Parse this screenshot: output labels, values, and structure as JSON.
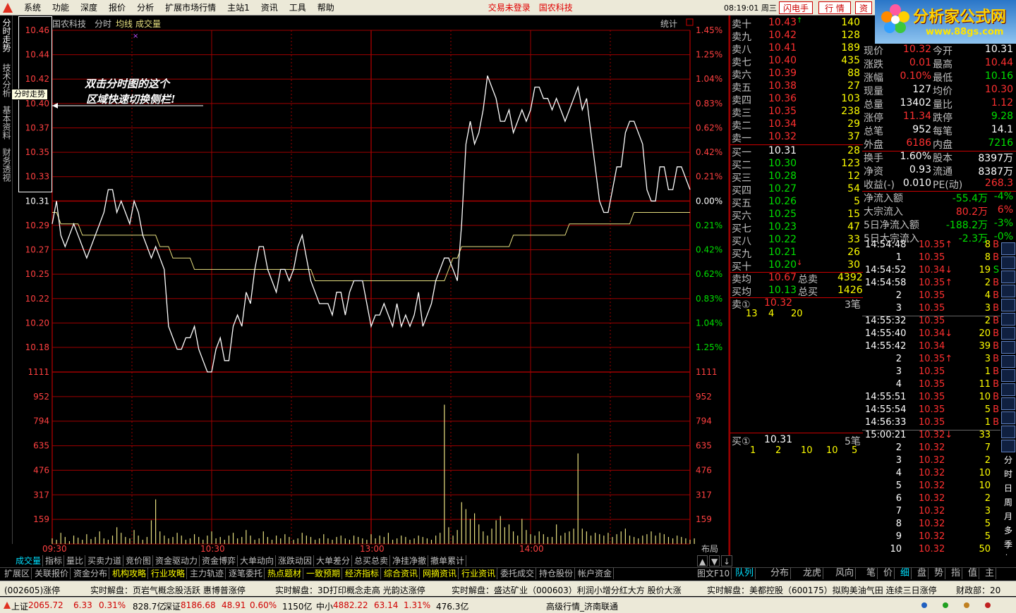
{
  "menu": {
    "items": [
      "系统",
      "功能",
      "深度",
      "报价",
      "分析",
      "扩展市场行情",
      "主站1",
      "资讯",
      "工具",
      "帮助"
    ],
    "status_login": "交易未登录",
    "stock_name_top": "国农科技",
    "clock": "08:19:01 周三",
    "btn_flash": "闪电手",
    "btn_quote": "行 情",
    "btn_asset": "资"
  },
  "brand": {
    "title": "分析家公式网",
    "url": "www.88gs.com",
    "code_faint": "000004 国农科技"
  },
  "side_tabs": [
    "分时走势",
    "技术分析",
    "基本资料",
    "财务透视"
  ],
  "tooltip": "分时走势",
  "annotation": [
    "双击分时图的这个",
    "区域快速切换侧栏!"
  ],
  "chart_header": {
    "name": "国农科技",
    "mode": "分时",
    "avg": "均线",
    "vol": "成交量",
    "stat": "统计",
    "close_box": "□"
  },
  "chart_data": {
    "type": "line",
    "price_axis": [
      "10.46",
      "10.44",
      "10.42",
      "10.40",
      "10.37",
      "10.35",
      "10.33",
      "10.31",
      "10.29",
      "10.27",
      "10.25",
      "10.22",
      "10.20",
      "10.18"
    ],
    "pct_axis": [
      "1.45%",
      "1.25%",
      "1.04%",
      "0.83%",
      "0.62%",
      "0.42%",
      "0.21%",
      "0.00%",
      "0.21%",
      "0.42%",
      "0.62%",
      "0.83%",
      "1.04%",
      "1.25%"
    ],
    "vol_axis": [
      "1111",
      "952",
      "794",
      "635",
      "476",
      "317",
      "159"
    ],
    "time_labels": [
      "09:30",
      "10:30",
      "13:00",
      "14:00"
    ],
    "layout_label": "布局",
    "prev_close": 10.31,
    "ylim": [
      10.16,
      10.47
    ],
    "price": [
      10.29,
      10.31,
      10.28,
      10.27,
      10.28,
      10.29,
      10.28,
      10.27,
      10.26,
      10.27,
      10.28,
      10.29,
      10.3,
      10.32,
      10.32,
      10.3,
      10.31,
      10.3,
      10.29,
      10.31,
      10.3,
      10.28,
      10.27,
      10.26,
      10.27,
      10.26,
      10.25,
      10.2,
      10.19,
      10.18,
      10.18,
      10.19,
      10.19,
      10.2,
      10.18,
      10.17,
      10.16,
      10.16,
      10.18,
      10.19,
      10.17,
      10.17,
      10.2,
      10.21,
      10.2,
      10.23,
      10.22,
      10.25,
      10.27,
      10.27,
      10.25,
      10.24,
      10.23,
      10.25,
      10.25,
      10.24,
      10.25,
      10.27,
      10.28,
      10.26,
      10.24,
      10.23,
      10.22,
      10.22,
      10.22,
      10.21,
      10.23,
      10.23,
      10.21,
      10.23,
      10.24,
      10.24,
      10.24,
      10.22,
      10.2,
      10.21,
      10.21,
      10.22,
      10.21,
      10.2,
      10.22,
      10.2,
      10.21,
      10.2,
      10.21,
      10.23,
      10.2,
      10.21,
      10.22,
      10.24,
      10.25,
      10.26,
      10.26,
      10.25,
      10.24,
      10.29,
      10.36,
      10.38,
      10.36,
      10.37,
      10.39,
      10.42,
      10.41,
      10.4,
      10.38,
      10.38,
      10.39,
      10.37,
      10.38,
      10.39,
      10.38,
      10.39,
      10.41,
      10.41,
      10.4,
      10.4,
      10.39,
      10.4,
      10.39,
      10.38,
      10.39,
      10.4,
      10.41,
      10.39,
      10.4,
      10.37,
      10.34,
      10.31,
      10.3,
      10.3,
      10.32,
      10.34,
      10.34,
      10.37,
      10.38,
      10.38,
      10.37,
      10.36,
      10.32,
      10.31,
      10.31,
      10.34,
      10.34,
      10.32,
      10.32,
      10.34,
      10.34,
      10.33,
      10.32
    ],
    "avg": [
      10.3,
      10.3,
      10.29,
      10.29,
      10.29,
      10.29,
      10.29,
      10.28,
      10.28,
      10.28,
      10.28,
      10.28,
      10.28,
      10.28,
      10.28,
      10.28,
      10.28,
      10.28,
      10.28,
      10.28,
      10.28,
      10.28,
      10.28,
      10.28,
      10.28,
      10.27,
      10.27,
      10.27,
      10.26,
      10.26,
      10.26,
      10.26,
      10.26,
      10.25,
      10.25,
      10.25,
      10.25,
      10.25,
      10.25,
      10.25,
      10.25,
      10.25,
      10.25,
      10.25,
      10.25,
      10.25,
      10.25,
      10.25,
      10.25,
      10.25,
      10.25,
      10.25,
      10.25,
      10.25,
      10.25,
      10.25,
      10.25,
      10.25,
      10.25,
      10.25,
      10.25,
      10.24,
      10.24,
      10.24,
      10.24,
      10.24,
      10.24,
      10.24,
      10.24,
      10.24,
      10.24,
      10.24,
      10.24,
      10.24,
      10.24,
      10.24,
      10.24,
      10.24,
      10.24,
      10.24,
      10.24,
      10.24,
      10.24,
      10.24,
      10.24,
      10.24,
      10.24,
      10.24,
      10.24,
      10.24,
      10.24,
      10.24,
      10.25,
      10.26,
      10.26,
      10.27,
      10.27,
      10.27,
      10.27,
      10.27,
      10.27,
      10.27,
      10.27,
      10.27,
      10.27,
      10.27,
      10.27,
      10.28,
      10.28,
      10.28,
      10.28,
      10.28,
      10.28,
      10.28,
      10.28,
      10.28,
      10.28,
      10.28,
      10.28,
      10.28,
      10.29,
      10.29,
      10.29,
      10.29,
      10.29,
      10.29,
      10.29,
      10.29,
      10.29,
      10.29,
      10.29,
      10.29,
      10.29,
      10.29,
      10.29,
      10.3,
      10.3,
      10.3,
      10.3,
      10.3,
      10.3,
      10.3,
      10.3,
      10.3,
      10.3,
      10.3,
      10.3,
      10.3,
      10.3
    ],
    "volume": [
      40,
      30,
      80,
      50,
      20,
      60,
      45,
      30,
      70,
      35,
      50,
      90,
      40,
      30,
      60,
      120,
      80,
      50,
      40,
      100,
      60,
      30,
      50,
      170,
      320,
      90,
      60,
      40,
      50,
      80,
      60,
      30,
      40,
      70,
      50,
      30,
      60,
      90,
      40,
      50,
      30,
      60,
      80,
      40,
      50,
      100,
      60,
      30,
      40,
      90,
      50,
      30,
      60,
      40,
      70,
      50,
      30,
      40,
      80,
      60,
      50,
      30,
      40,
      70,
      40,
      30,
      50,
      60,
      40,
      30,
      60,
      50,
      40,
      30,
      70,
      40,
      60,
      50,
      80,
      30,
      40,
      60,
      50,
      30,
      40,
      60,
      50,
      40,
      30,
      60,
      80,
      1000,
      120,
      60,
      100,
      300,
      250,
      180,
      220,
      140,
      90,
      60,
      110,
      170,
      200,
      120,
      140,
      90,
      60,
      180,
      100,
      70,
      60,
      90,
      70,
      50,
      50,
      140,
      60,
      80,
      90,
      110,
      650,
      110,
      90,
      60,
      80,
      70,
      60,
      80,
      50,
      70,
      90,
      110,
      60,
      50,
      40,
      60,
      70,
      90,
      60,
      80,
      70,
      50,
      40,
      60,
      50,
      40,
      30,
      40
    ]
  },
  "order_book": {
    "sell": [
      {
        "label": "卖十",
        "price": "10.43",
        "vol": "140",
        "mark": "↑"
      },
      {
        "label": "卖九",
        "price": "10.42",
        "vol": "128"
      },
      {
        "label": "卖八",
        "price": "10.41",
        "vol": "189"
      },
      {
        "label": "卖七",
        "price": "10.40",
        "vol": "435"
      },
      {
        "label": "卖六",
        "price": "10.39",
        "vol": "88"
      },
      {
        "label": "卖五",
        "price": "10.38",
        "vol": "27"
      },
      {
        "label": "卖四",
        "price": "10.36",
        "vol": "103"
      },
      {
        "label": "卖三",
        "price": "10.35",
        "vol": "238"
      },
      {
        "label": "卖二",
        "price": "10.34",
        "vol": "29"
      },
      {
        "label": "卖一",
        "price": "10.32",
        "vol": "37"
      }
    ],
    "buy": [
      {
        "label": "买一",
        "price": "10.31",
        "vol": "28"
      },
      {
        "label": "买二",
        "price": "10.30",
        "vol": "123"
      },
      {
        "label": "买三",
        "price": "10.28",
        "vol": "12"
      },
      {
        "label": "买四",
        "price": "10.27",
        "vol": "54"
      },
      {
        "label": "买五",
        "price": "10.26",
        "vol": "5"
      },
      {
        "label": "买六",
        "price": "10.25",
        "vol": "15"
      },
      {
        "label": "买七",
        "price": "10.23",
        "vol": "47"
      },
      {
        "label": "买八",
        "price": "10.22",
        "vol": "33"
      },
      {
        "label": "买九",
        "price": "10.21",
        "vol": "26"
      },
      {
        "label": "买十",
        "price": "10.20",
        "vol": "30",
        "mark": "↓"
      }
    ],
    "sell_avg_label": "卖均",
    "sell_avg": "10.67",
    "total_sell_label": "总卖",
    "total_sell": "4392",
    "buy_avg_label": "买均",
    "buy_avg": "10.13",
    "total_buy_label": "总买",
    "total_buy": "1426",
    "s1_label": "卖①",
    "s1_price": "10.32",
    "s1_count": "3笔",
    "s1_queue": [
      "13",
      "4",
      "20"
    ],
    "b1_label": "买①",
    "b1_price": "10.31",
    "b1_count": "5笔",
    "b1_queue": [
      "1",
      "2",
      "10",
      "10",
      "5"
    ]
  },
  "quote": [
    [
      "现价",
      "10.32",
      "今开",
      "10.31"
    ],
    [
      "涨跌",
      "0.01",
      "最高",
      "10.44"
    ],
    [
      "涨幅",
      "0.10%",
      "最低",
      "10.16"
    ],
    [
      "现量",
      "127",
      "均价",
      "10.30"
    ],
    [
      "总量",
      "13402",
      "量比",
      "1.12"
    ],
    [
      "涨停",
      "11.34",
      "跌停",
      "9.28"
    ],
    [
      "总笔",
      "952",
      "每笔",
      "14.1"
    ],
    [
      "外盘",
      "6186",
      "内盘",
      "7216"
    ],
    [
      "换手",
      "1.60%",
      "股本",
      "8397万"
    ],
    [
      "净资",
      "0.93",
      "流通",
      "8387万"
    ],
    [
      "收益(-)",
      "0.010",
      "PE(动)",
      "268.3"
    ],
    [
      "净流入额",
      "",
      "-55.4万",
      "-4%"
    ],
    [
      "大宗流入",
      "",
      "80.2万",
      "6%"
    ],
    [
      "5日净流入额",
      "",
      "-188.2万",
      "-3%"
    ],
    [
      "5日大宗流入",
      "",
      "-2.3万",
      "-0%"
    ]
  ],
  "ticks": [
    [
      "14:54:48",
      "10.35",
      "↑",
      "8",
      "B"
    ],
    [
      "1",
      "10.35",
      "",
      "8",
      "B"
    ],
    [
      "14:54:52",
      "10.34",
      "↓",
      "19",
      "S"
    ],
    [
      "14:54:58",
      "10.35",
      "↑",
      "2",
      "B"
    ],
    [
      "2",
      "10.35",
      "",
      "4",
      "B"
    ],
    [
      "3",
      "10.35",
      "",
      "3",
      "B"
    ],
    [
      "14:55:32",
      "10.35",
      "",
      "2",
      "B"
    ],
    [
      "14:55:40",
      "10.34",
      "↓",
      "20",
      "B"
    ],
    [
      "14:55:42",
      "10.34",
      "",
      "39",
      "B"
    ],
    [
      "2",
      "10.35",
      "↑",
      "3",
      "B"
    ],
    [
      "3",
      "10.35",
      "",
      "1",
      "B"
    ],
    [
      "4",
      "10.35",
      "",
      "11",
      "B"
    ],
    [
      "14:55:51",
      "10.35",
      "",
      "10",
      "B"
    ],
    [
      "14:55:54",
      "10.35",
      "",
      "5",
      "B"
    ],
    [
      "14:56:33",
      "10.35",
      "",
      "1",
      "B"
    ],
    [
      "15:00:21",
      "10.32",
      "↓",
      "33",
      ""
    ],
    [
      "2",
      "10.32",
      "",
      "7",
      ""
    ],
    [
      "3",
      "10.32",
      "",
      "2",
      ""
    ],
    [
      "4",
      "10.32",
      "",
      "10",
      ""
    ],
    [
      "5",
      "10.32",
      "",
      "10",
      ""
    ],
    [
      "6",
      "10.32",
      "",
      "2",
      ""
    ],
    [
      "7",
      "10.32",
      "",
      "3",
      ""
    ],
    [
      "8",
      "10.32",
      "",
      "5",
      ""
    ],
    [
      "9",
      "10.32",
      "",
      "5",
      ""
    ],
    [
      "10",
      "10.32",
      "",
      "50",
      ""
    ]
  ],
  "right_tabs": [
    "",
    "",
    "",
    "",
    "",
    "",
    "",
    "",
    "",
    "",
    "",
    "",
    "",
    "",
    "",
    "分",
    "时",
    "日",
    "周",
    "月",
    "多",
    "季",
    "年"
  ],
  "book_tabs": [
    "队列",
    "分布",
    "龙虎",
    "风向",
    "笔",
    "价",
    "细",
    "盘",
    "势",
    "指",
    "值",
    "主"
  ],
  "bottom_tabs1": [
    "成交量",
    "指标",
    "量比",
    "买卖力道",
    "竞价图",
    "资金驱动力",
    "资金博弈",
    "大单动向",
    "涨跌动因",
    "大单差分",
    "总买总卖",
    "净挂净撤",
    "撤单累计"
  ],
  "bottom_tabs2": [
    "扩展区",
    "关联报价",
    "资金分布",
    "机构攻略",
    "行业攻略",
    "主力轨迹",
    "逐笔委托",
    "热点题材",
    "一致预期",
    "经济指标",
    "综合资讯",
    "网摘资讯",
    "行业资讯",
    "委托成交",
    "持仓股份",
    "帐户资金"
  ],
  "pager": [
    "▲",
    "▼",
    "↓"
  ],
  "figure_label": "图文F10",
  "ticker": [
    "(002605)涨停",
    "实时解盘：页岩气概念股活跃 惠博普涨停",
    "实时解盘：3D打印概念走高 光韵达涨停",
    "实时解盘：盛达矿业（000603）利润小增分红大方 股价大涨",
    "实时解盘：美都控股（600175）拟购美油气田 连续三日涨停",
    "财政部：20"
  ],
  "status": {
    "sh_label": "上证",
    "sh": "2065.72",
    "sh_chg": "6.33",
    "sh_pct": "0.31%",
    "sh_amt": "828.7亿",
    "sz_label": "深证",
    "sz": "8186.68",
    "sz_chg": "48.91",
    "sz_pct": "0.60%",
    "sz_amt": "1150亿",
    "zx_label": "中小",
    "zx": "4882.22",
    "zx_chg": "63.14",
    "zx_pct": "1.31%",
    "zx_amt": "476.3亿",
    "server": "高级行情_济南联通"
  }
}
